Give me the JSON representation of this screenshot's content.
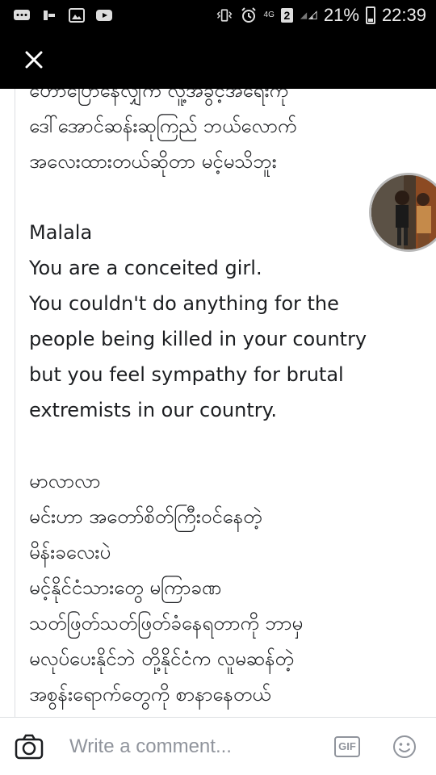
{
  "status_bar": {
    "network": "4G",
    "sim_slot": "2",
    "battery_percent": "21%",
    "time": "22:39",
    "icons": [
      "chat-icon",
      "notification-icon",
      "gallery-icon",
      "youtube-icon",
      "vibrate-icon",
      "alarm-icon",
      "signal-icon",
      "battery-icon"
    ]
  },
  "toolbar": {
    "close_icon": "close-icon"
  },
  "post": {
    "paragraphs": [
      "ဟောပြောနေလျှက် လူ့အခွင့်အရေးကို",
      "ဒေါ်အောင်ဆန်းဆုကြည် ဘယ်လောက်",
      "အလေးထားတယ်ဆိုတာ မင့်မသိဘူး",
      "",
      "Malala",
      "You are a conceited girl.",
      "You couldn't do anything for the people being killed in your country but you feel sympathy for brutal extremists in our country.",
      "",
      "မာလာလာ",
      "မင်းဟာ အတော်စိတ်ကြီးဝင်နေတဲ့",
      "မိန်းခလေးပဲ",
      "မင့်နိုင်ငံသားတွေ မကြာခဏ",
      "သတ်ဖြတ်သတ်ဖြတ်ခံနေရတာကို ဘာမှ",
      "မလုပ်ပေးနိုင်ဘဲ တို့နိုင်ငံက လူမဆန်တဲ့",
      "အစွန်းရောက်တွေကို စာနာနေတယ်"
    ]
  },
  "chat_head": {
    "icon": "chat-head-avatar"
  },
  "comment_bar": {
    "placeholder": "Write a comment...",
    "gif_label": "GIF",
    "camera_icon": "camera-icon",
    "emoji_icon": "emoji-icon"
  }
}
